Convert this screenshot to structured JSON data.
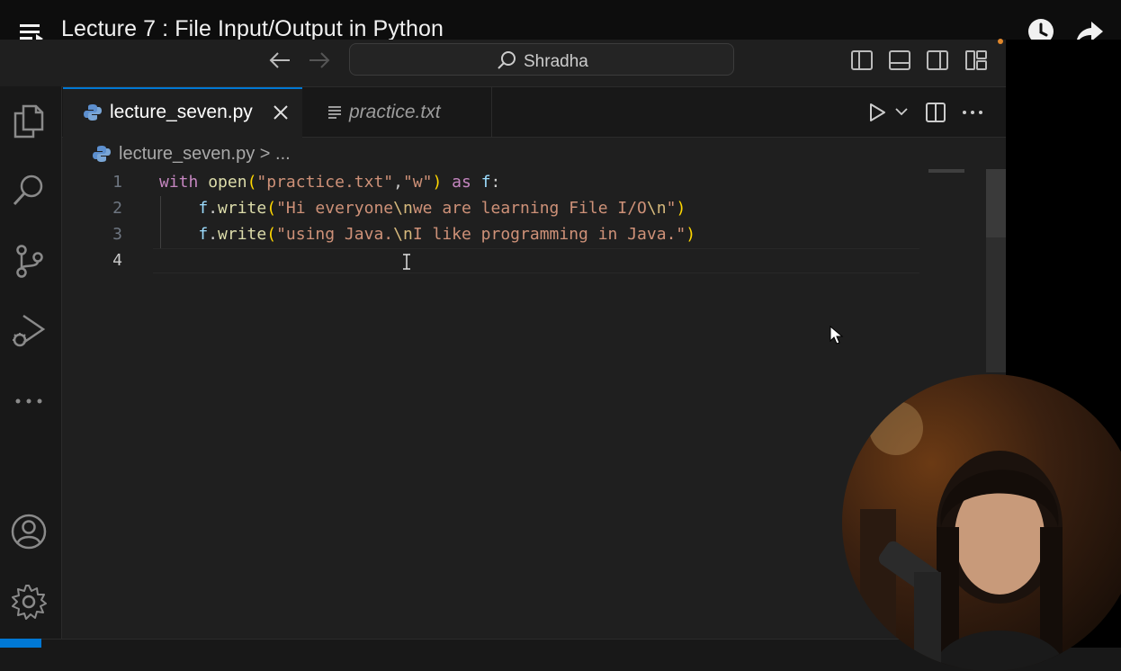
{
  "video": {
    "title": "Lecture 7 : File Input/Output in Python"
  },
  "titlebar": {
    "search_text": "Shradha"
  },
  "tabs": [
    {
      "label": "lecture_seven.py",
      "active": true
    },
    {
      "label": "practice.txt",
      "active": false
    }
  ],
  "breadcrumb": {
    "file": "lecture_seven.py",
    "separator": ">",
    "rest": "..."
  },
  "editor": {
    "lines": [
      {
        "number": "1",
        "text": "with open(\"practice.txt\",\"w\") as f:"
      },
      {
        "number": "2",
        "text": "    f.write(\"Hi everyone\\nwe are learning File I/O\\n\")"
      },
      {
        "number": "3",
        "text": "    f.write(\"using Java.\\nI like programming in Java.\")"
      },
      {
        "number": "4",
        "text": ""
      }
    ],
    "active_line": "4"
  },
  "colors": {
    "accent": "#0078d4",
    "keyword": "#c586c0",
    "function": "#dcdcaa",
    "string": "#ce9178",
    "variable": "#9cdcfe",
    "background": "#1f1f1f"
  },
  "icons": {
    "activity_bar": [
      "explorer-icon",
      "search-icon",
      "source-control-icon",
      "run-debug-icon",
      "more-icon",
      "account-icon",
      "settings-gear-icon"
    ],
    "overlay": [
      "queue-icon",
      "watch-later-icon",
      "share-icon"
    ]
  }
}
